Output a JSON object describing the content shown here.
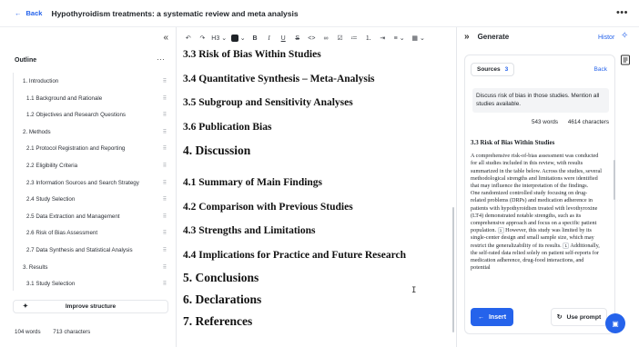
{
  "header": {
    "back_label": "Back",
    "title": "Hypothyroidism treatments: a systematic review and meta analysis"
  },
  "outline": {
    "heading": "Outline",
    "items": [
      {
        "label": "1. Introduction",
        "level": 1
      },
      {
        "label": "1.1 Background and Rationale",
        "level": 2
      },
      {
        "label": "1.2 Objectives and Research Questions",
        "level": 2
      },
      {
        "label": "2. Methods",
        "level": 1
      },
      {
        "label": "2.1 Protocol Registration and Reporting",
        "level": 2
      },
      {
        "label": "2.2 Eligibility Criteria",
        "level": 2
      },
      {
        "label": "2.3 Information Sources and Search Strategy",
        "level": 2
      },
      {
        "label": "2.4 Study Selection",
        "level": 2
      },
      {
        "label": "2.5 Data Extraction and Management",
        "level": 2
      },
      {
        "label": "2.6 Risk of Bias Assessment",
        "level": 2
      },
      {
        "label": "2.7 Data Synthesis and Statistical Analysis",
        "level": 2
      },
      {
        "label": "3. Results",
        "level": 1
      },
      {
        "label": "3.1 Study Selection",
        "level": 2
      }
    ],
    "improve_label": "Improve structure",
    "word_count": "104 words",
    "char_count": "713 characters"
  },
  "toolbar": {
    "heading_select": "H3"
  },
  "document": {
    "headings": [
      {
        "text": "3.3 Risk of Bias Within Studies",
        "level": 3
      },
      {
        "text": "3.4 Quantitative Synthesis – Meta-Analysis",
        "level": 3
      },
      {
        "text": "3.5 Subgroup and Sensitivity Analyses",
        "level": 3
      },
      {
        "text": "3.6 Publication Bias",
        "level": 3
      },
      {
        "text": "4. Discussion",
        "level": 2
      },
      {
        "text": "4.1 Summary of Main Findings",
        "level": 3
      },
      {
        "text": "4.2 Comparison with Previous Studies",
        "level": 3
      },
      {
        "text": "4.3 Strengths and Limitations",
        "level": 3
      },
      {
        "text": "4.4 Implications for Practice and Future Research",
        "level": 3
      },
      {
        "text": "5. Conclusions",
        "level": 2
      },
      {
        "text": "6. Declarations",
        "level": 2
      },
      {
        "text": "7. References",
        "level": 2
      }
    ]
  },
  "generate": {
    "title": "Generate",
    "history_label": "Histor",
    "sources_label": "Sources",
    "sources_count": "3",
    "back_label": "Back",
    "prompt": "Discuss risk of bias in those studies. Mention all studies available.",
    "word_count": "543 words",
    "char_count": "4614 characters",
    "answer_heading": "3.3 Risk of Bias Within Studies",
    "answer_p1": "A comprehensive risk-of-bias assessment was conducted for all studies included in this review, with results summarized in the table below. Across the studies, several methodological strengths and limitations were identified that may influence the interpretation of the findings.",
    "answer_p2a": "One randomized controlled study focusing on drug-related problems (DRPs) and medication adherence in patients with hypothyroidism treated with levothyroxine (LT4) demonstrated notable strengths, such as its comprehensive approach and focus on a specific patient population.",
    "answer_p2b": "However, this study was limited by its single-center design and small sample size, which may restrict the generalizability of its results.",
    "answer_p2c": "Additionally, the self-rated data relied solely on patient self-reports for medication adherence, drug-food interactions, and potential",
    "cite1": "1",
    "cite2": "1",
    "insert_label": "Insert",
    "use_prompt_label": "Use prompt"
  }
}
